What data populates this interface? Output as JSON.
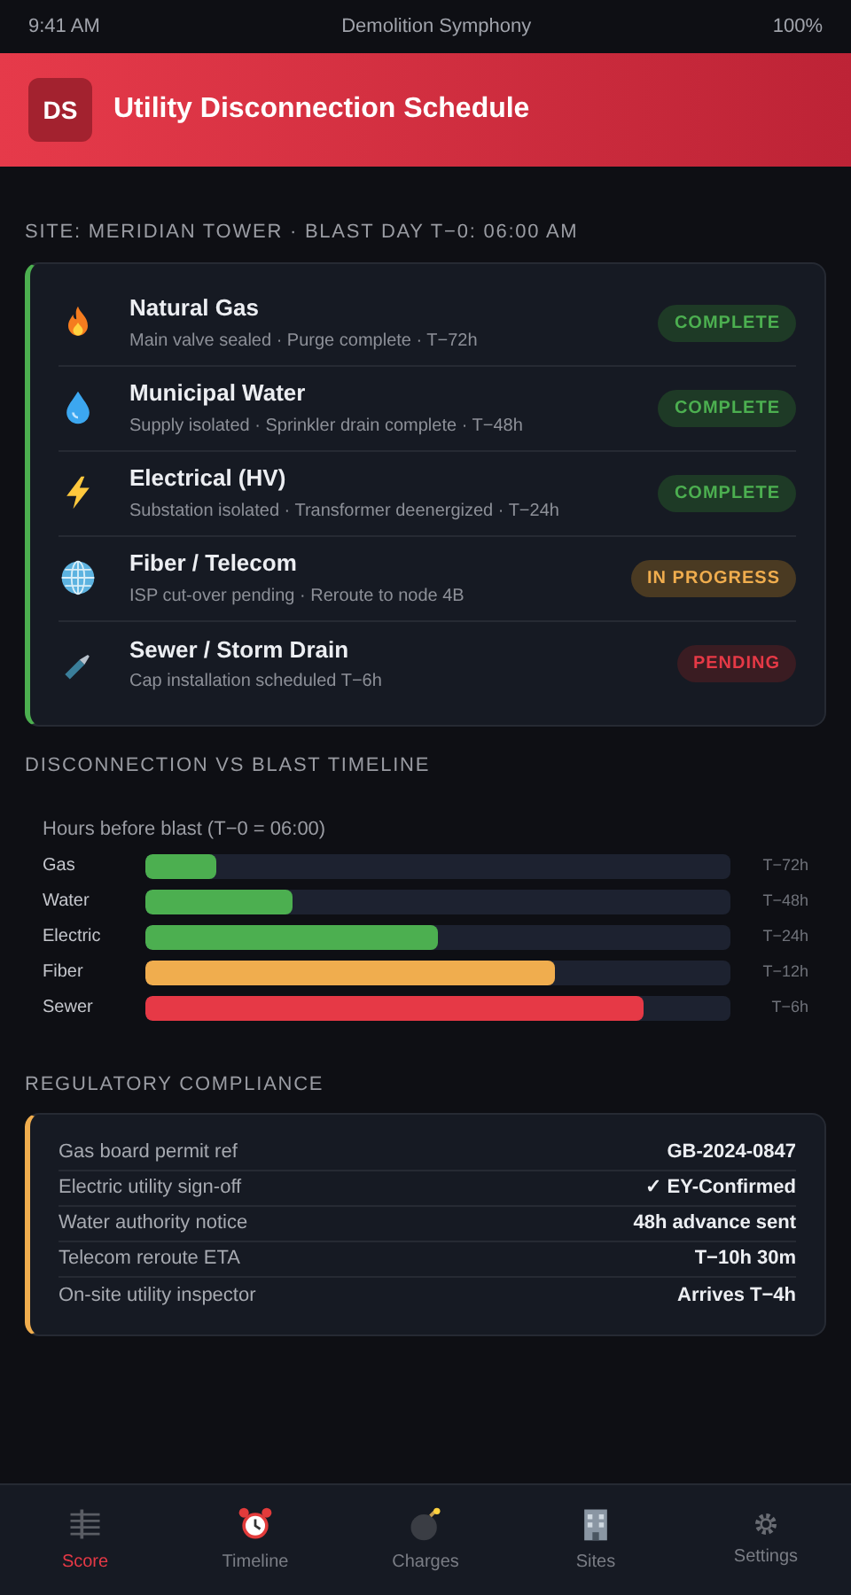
{
  "status_bar": {
    "time": "9:41 AM",
    "title": "Demolition Symphony",
    "battery": "100%"
  },
  "header": {
    "logo": "DS",
    "title": "Utility Disconnection Schedule"
  },
  "site_label": "SITE: MERIDIAN TOWER · BLAST DAY T−0: 06:00 AM",
  "utilities": [
    {
      "kind": "flame",
      "name": "Natural Gas",
      "detail": "Main valve sealed · Purge complete · T−72h",
      "badge": {
        "kind": "complete",
        "text": "COMPLETE"
      }
    },
    {
      "kind": "drop",
      "name": "Municipal Water",
      "detail": "Supply isolated · Sprinkler drain complete · T−48h",
      "badge": {
        "kind": "complete",
        "text": "COMPLETE"
      }
    },
    {
      "kind": "bolt",
      "name": "Electrical (HV)",
      "detail": "Substation isolated · Transformer deenergized · T−24h",
      "badge": {
        "kind": "complete",
        "text": "COMPLETE"
      }
    },
    {
      "kind": "globe",
      "name": "Fiber / Telecom",
      "detail": "ISP cut-over pending · Reroute to node 4B",
      "badge": {
        "kind": "in_progress",
        "text": "IN PROGRESS"
      }
    },
    {
      "kind": "pipe",
      "name": "Sewer / Storm Drain",
      "detail": "Cap installation scheduled T−6h",
      "badge": {
        "kind": "pending",
        "text": "PENDING"
      }
    }
  ],
  "timeline": {
    "heading": "DISCONNECTION VS BLAST TIMELINE",
    "subtitle": "Hours before blast (T−0 = 06:00)",
    "bars": [
      {
        "label": "Gas",
        "level": 0.12,
        "color": "#4caf50",
        "reading": "T−72h"
      },
      {
        "label": "Water",
        "level": 0.25,
        "color": "#4caf50",
        "reading": "T−48h"
      },
      {
        "label": "Electric",
        "level": 0.5,
        "color": "#4caf50",
        "reading": "T−24h"
      },
      {
        "label": "Fiber",
        "level": 0.7,
        "color": "#f0ad4e",
        "reading": "T−12h"
      },
      {
        "label": "Sewer",
        "level": 0.85,
        "color": "#e63946",
        "reading": "T−6h"
      }
    ]
  },
  "compliance": {
    "heading": "REGULATORY COMPLIANCE",
    "rows": [
      {
        "label": "Gas board permit ref",
        "value": "GB-2024-0847"
      },
      {
        "label": "Electric utility sign-off",
        "value": "✓ EY-Confirmed"
      },
      {
        "label": "Water authority notice",
        "value": "48h advance sent"
      },
      {
        "label": "Telecom reroute ETA",
        "value": "T−10h 30m"
      },
      {
        "label": "On-site utility inspector",
        "value": "Arrives T−4h"
      }
    ]
  },
  "nav": [
    {
      "kind": "score",
      "label": "Score",
      "selected": true
    },
    {
      "kind": "clock",
      "label": "Timeline",
      "selected": false
    },
    {
      "kind": "bomb",
      "label": "Charges",
      "selected": false
    },
    {
      "kind": "building",
      "label": "Sites",
      "selected": false
    },
    {
      "kind": "gear",
      "label": "Settings",
      "selected": false
    }
  ]
}
